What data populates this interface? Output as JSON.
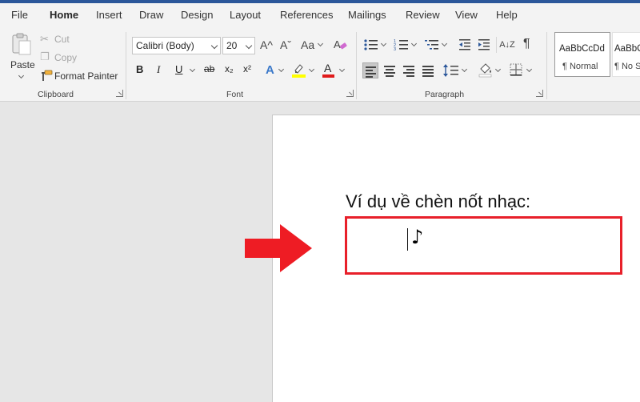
{
  "menu": {
    "tabs": [
      "File",
      "Home",
      "Insert",
      "Draw",
      "Design",
      "Layout",
      "References",
      "Mailings",
      "Review",
      "View",
      "Help"
    ],
    "active": "Home"
  },
  "clipboard": {
    "paste": "Paste",
    "cut": "Cut",
    "copy": "Copy",
    "format_painter": "Format Painter",
    "label": "Clipboard"
  },
  "font": {
    "family": "Calibri (Body)",
    "size": "20",
    "label": "Font",
    "grow_icon": "A^",
    "shrink_icon": "Aˇ",
    "case_icon": "Aa",
    "bold": "B",
    "italic": "I",
    "underline": "U",
    "strike": "ab",
    "subscript": "x₂",
    "superscript": "x²",
    "effects": "A",
    "highlight_color": "#ffff00",
    "font_color": "#e01b1b",
    "font_color_glyph": "A"
  },
  "paragraph": {
    "label": "Paragraph",
    "sort_icon": "A↓Z",
    "pilcrow": "¶"
  },
  "styles": {
    "items": [
      {
        "sample": "AaBbCcDd",
        "name": "¶ Normal"
      },
      {
        "sample": "AaBbCcDd",
        "name": "¶ No Spac"
      }
    ]
  },
  "document": {
    "heading": "Ví dụ về chèn nốt nhạc:",
    "inserted_symbol": "♪"
  },
  "colors": {
    "accent": "#2b579a",
    "annotation": "#e8202a"
  }
}
